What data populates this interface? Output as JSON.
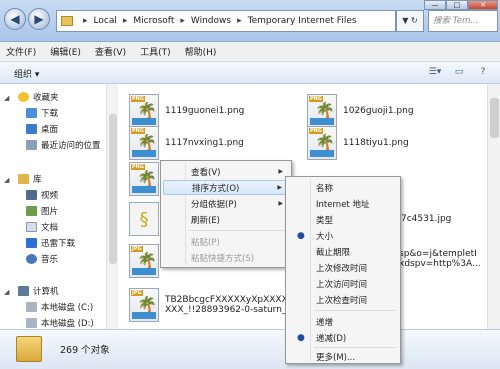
{
  "titlebar": {
    "breadcrumb": [
      "Local",
      "Microsoft",
      "Windows",
      "Temporary Internet Files"
    ],
    "search_placeholder": "搜索 Tem...",
    "back_glyph": "◀",
    "forward_glyph": "▶",
    "breadcrumb_sep": "▸",
    "addr_arrows": "▼ ↻",
    "win_min": "—",
    "win_max": "□",
    "win_close": "✕"
  },
  "menubar": {
    "items": [
      "文件(F)",
      "编辑(E)",
      "查看(V)",
      "工具(T)",
      "帮助(H)"
    ]
  },
  "toolbar": {
    "organize_label": "组织 ▾",
    "icon_glyphs": [
      "☰▾",
      "▭",
      "?"
    ]
  },
  "navpane": {
    "items": [
      {
        "label": "收藏夹",
        "icon": "star-icon"
      },
      {
        "label": "下载",
        "icon": "download-folder-icon"
      },
      {
        "label": "桌面",
        "icon": "desktop-icon"
      },
      {
        "label": "最近访问的位置",
        "icon": "recent-places-icon"
      },
      {
        "label": "库",
        "icon": "library-icon"
      },
      {
        "label": "视频",
        "icon": "video-library-icon"
      },
      {
        "label": "图片",
        "icon": "pictures-library-icon"
      },
      {
        "label": "文档",
        "icon": "documents-library-icon"
      },
      {
        "label": "迅雷下载",
        "icon": "thunder-download-icon"
      },
      {
        "label": "音乐",
        "icon": "music-library-icon"
      },
      {
        "label": "计算机",
        "icon": "computer-icon"
      },
      {
        "label": "本地磁盘 (C:)",
        "icon": "drive-c-icon"
      },
      {
        "label": "本地磁盘 (D:)",
        "icon": "drive-d-icon"
      }
    ]
  },
  "files": {
    "png_tag": "PNG",
    "jpg_tag": "JPG",
    "palm_glyph": "🌴",
    "generic_glyph": "§",
    "items": [
      {
        "name": "1119guonei1.png",
        "icon": "png-file-icon"
      },
      {
        "name": "1026guoji1.png",
        "icon": "png-file-icon"
      },
      {
        "name": "1117nvxing1.png",
        "icon": "png-file-icon"
      },
      {
        "name": "1118tiyu1.png",
        "icon": "png-file-icon"
      },
      {
        "name": "7c4531.jpg",
        "icon": "jpg-file-icon"
      },
      {
        "name": "sp&o=j&templetI",
        "icon": "generic-file-icon"
      },
      {
        "name": "xdspv=http%3A...",
        "icon": "generic-file-icon"
      },
      {
        "name": "TB2BbcgcFXXXXXyXpXXXXXX",
        "icon": "jpg-file-icon"
      },
      {
        "name": "XXX_!!28893962-0-saturn_sola",
        "icon": "jpg-file-icon"
      }
    ]
  },
  "status": {
    "object_count": "269 个对象"
  },
  "context_menu": {
    "items": [
      {
        "label": "查看(V)",
        "submenu": true,
        "disabled": false
      },
      {
        "label": "排序方式(O)",
        "submenu": true,
        "disabled": false,
        "highlighted": true
      },
      {
        "label": "分组依据(P)",
        "submenu": true,
        "disabled": false
      },
      {
        "label": "刷新(E)",
        "submenu": false,
        "disabled": false
      },
      {
        "label": "粘贴(P)",
        "submenu": false,
        "disabled": true
      },
      {
        "label": "粘贴快捷方式(S)",
        "submenu": false,
        "disabled": true
      }
    ],
    "arrow_glyph": "▶"
  },
  "sort_submenu": {
    "items": [
      "名称",
      "Internet 地址",
      "类型",
      "大小",
      "截止期限",
      "上次修改时间",
      "上次访问时间",
      "上次检查时间"
    ],
    "selected": "大小",
    "order_items": [
      "递增",
      "递减(D)"
    ],
    "order_selected": "递减(D)",
    "more_label": "更多(M)...",
    "bullet_glyph": "●"
  }
}
